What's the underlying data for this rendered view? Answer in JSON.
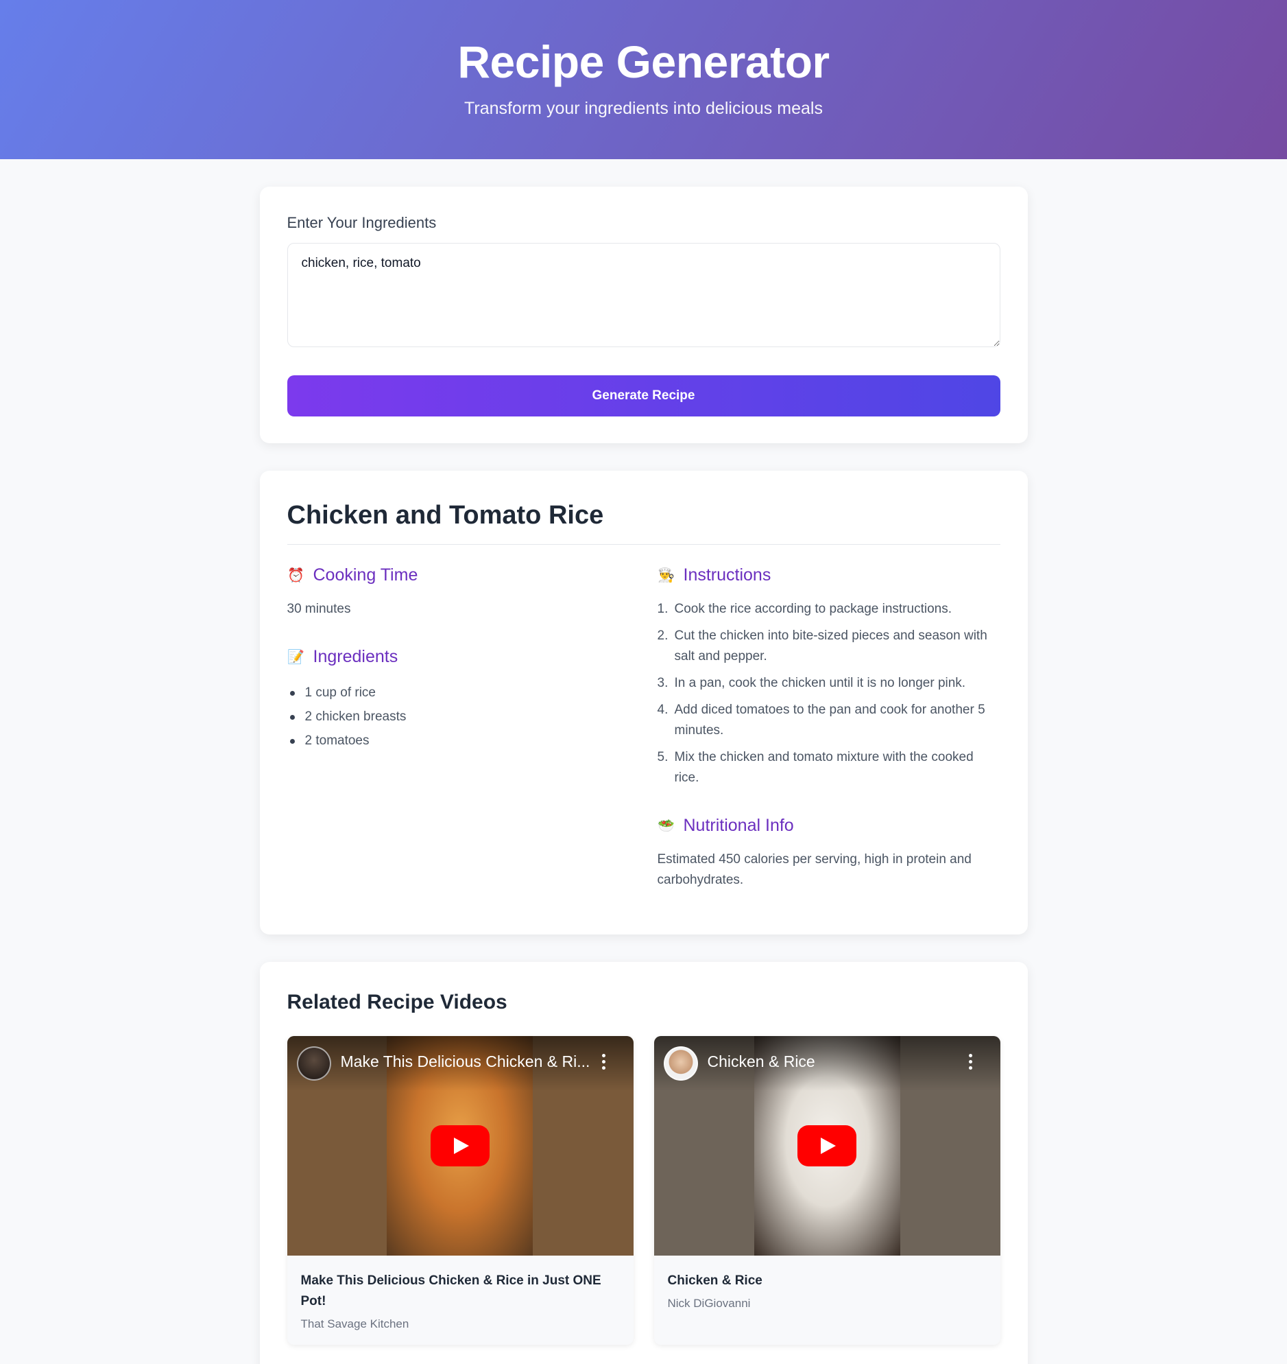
{
  "header": {
    "title": "Recipe Generator",
    "subtitle": "Transform your ingredients into delicious meals"
  },
  "input": {
    "label": "Enter Your Ingredients",
    "value": "chicken, rice, tomato",
    "button_label": "Generate Recipe"
  },
  "recipe": {
    "title": "Chicken and Tomato Rice",
    "cooking_time": {
      "heading": "Cooking Time",
      "icon": "alarm-clock-icon",
      "emoji": "⏰",
      "value": "30 minutes"
    },
    "ingredients": {
      "heading": "Ingredients",
      "icon": "memo-icon",
      "emoji": "📝",
      "items": [
        "1 cup of rice",
        "2 chicken breasts",
        "2 tomatoes"
      ]
    },
    "instructions": {
      "heading": "Instructions",
      "icon": "chef-icon",
      "emoji": "👨‍🍳",
      "steps": [
        "Cook the rice according to package instructions.",
        "Cut the chicken into bite-sized pieces and season with salt and pepper.",
        "In a pan, cook the chicken until it is no longer pink.",
        "Add diced tomatoes to the pan and cook for another 5 minutes.",
        "Mix the chicken and tomato mixture with the cooked rice."
      ]
    },
    "nutrition": {
      "heading": "Nutritional Info",
      "icon": "salad-icon",
      "emoji": "🥗",
      "value": "Estimated 450 calories per serving, high in protein and carbohydrates."
    }
  },
  "videos": {
    "title": "Related Recipe Videos",
    "items": [
      {
        "overlay_title": "Make This Delicious Chicken & Ri...",
        "title": "Make This Delicious Chicken & Rice in Just ONE Pot!",
        "channel": "That Savage Kitchen",
        "side_color": "#7a5a3a",
        "center_color": "#d8883a"
      },
      {
        "overlay_title": "Chicken & Rice",
        "title": "Chicken & Rice",
        "channel": "Nick DiGiovanni",
        "side_color": "#6e6459",
        "center_color": "#e8e4df"
      }
    ]
  }
}
